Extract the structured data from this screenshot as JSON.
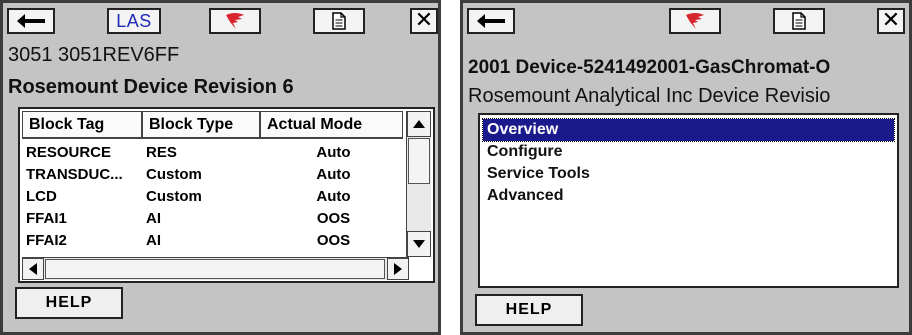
{
  "left_screen": {
    "toolbar": {
      "las_label": "LAS",
      "icons": [
        "back-arrow-icon",
        "las-button",
        "fieldbus-logo-icon",
        "document-icon",
        "close-icon"
      ]
    },
    "header": {
      "line1": "3051 3051REV6FF",
      "line2": "Rosemount Device Revision 6"
    },
    "table": {
      "columns": [
        "Block Tag",
        "Block Type",
        "Actual Mode"
      ],
      "rows": [
        [
          "RESOURCE",
          "RES",
          "Auto"
        ],
        [
          "TRANSDUC...",
          "Custom",
          "Auto"
        ],
        [
          "LCD",
          "Custom",
          "Auto"
        ],
        [
          "FFAI1",
          "AI",
          "OOS"
        ],
        [
          "FFAI2",
          "AI",
          "OOS"
        ]
      ]
    },
    "help_label": "HELP"
  },
  "right_screen": {
    "toolbar": {
      "icons": [
        "back-arrow-icon",
        "fieldbus-logo-icon",
        "document-icon",
        "close-icon"
      ]
    },
    "header": {
      "line1": "2001 Device-5241492001-GasChromat-O",
      "line2": "Rosemount Analytical Inc Device Revisio"
    },
    "menu": {
      "items": [
        "Overview",
        "Configure",
        "Service Tools",
        "Advanced"
      ],
      "selected": "Overview"
    },
    "help_label": "HELP"
  },
  "colors": {
    "screen_bg": "#c4c4c4",
    "selection": "#1a1a8c",
    "las_text": "#1f2bb5",
    "logo_red": "#d8262e"
  }
}
